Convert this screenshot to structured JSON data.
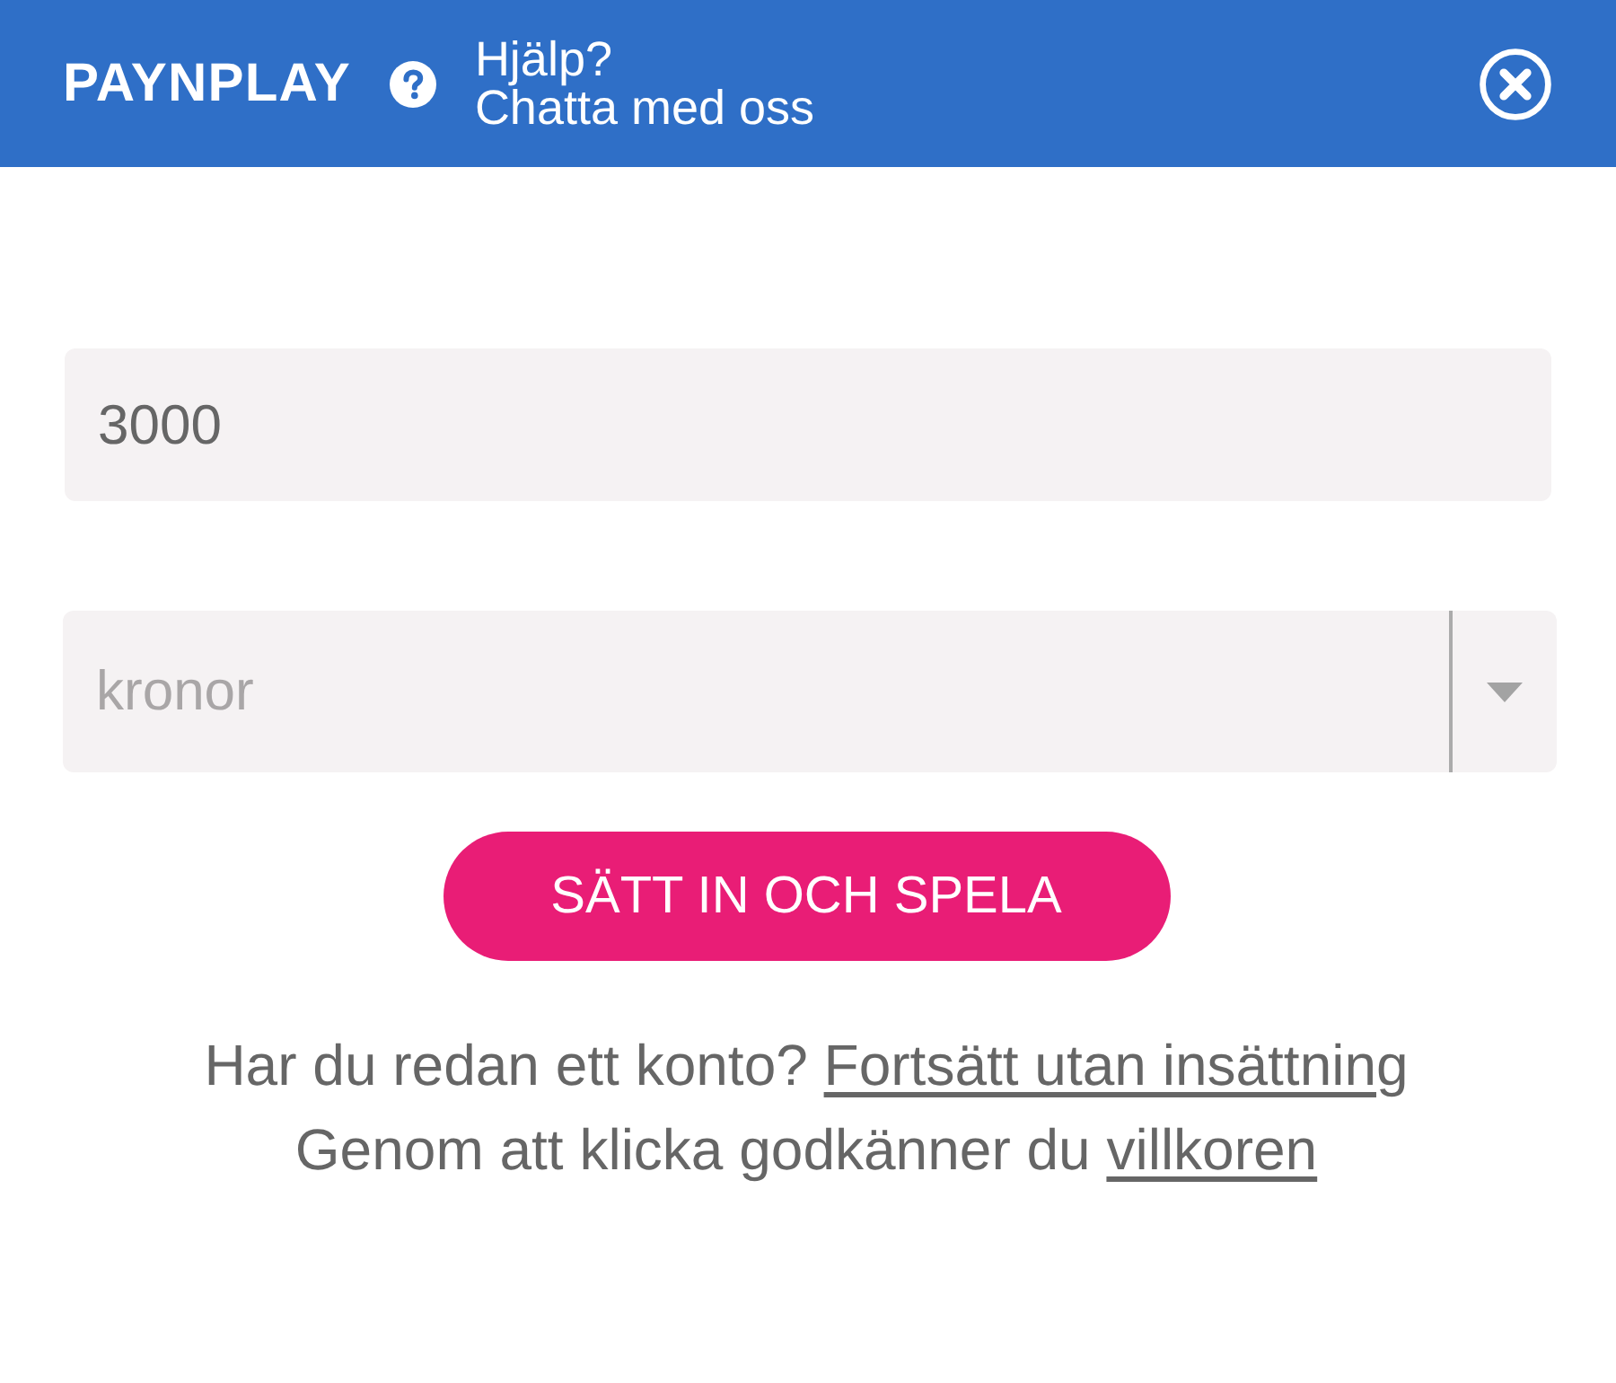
{
  "header": {
    "logo": "PAYNPLAY",
    "help": {
      "title": "Hjälp?",
      "subtitle": "Chatta med oss"
    }
  },
  "amount_field": {
    "value": "3000"
  },
  "currency_select": {
    "value": "kronor"
  },
  "submit_button": {
    "label": "SÄTT IN OCH SPELA"
  },
  "notes": [
    {
      "text": "Har du redan ett konto?",
      "link": "Fortsätt utan insättning"
    },
    {
      "text": "Genom att klicka godkänner du",
      "link": "villkoren"
    }
  ]
}
